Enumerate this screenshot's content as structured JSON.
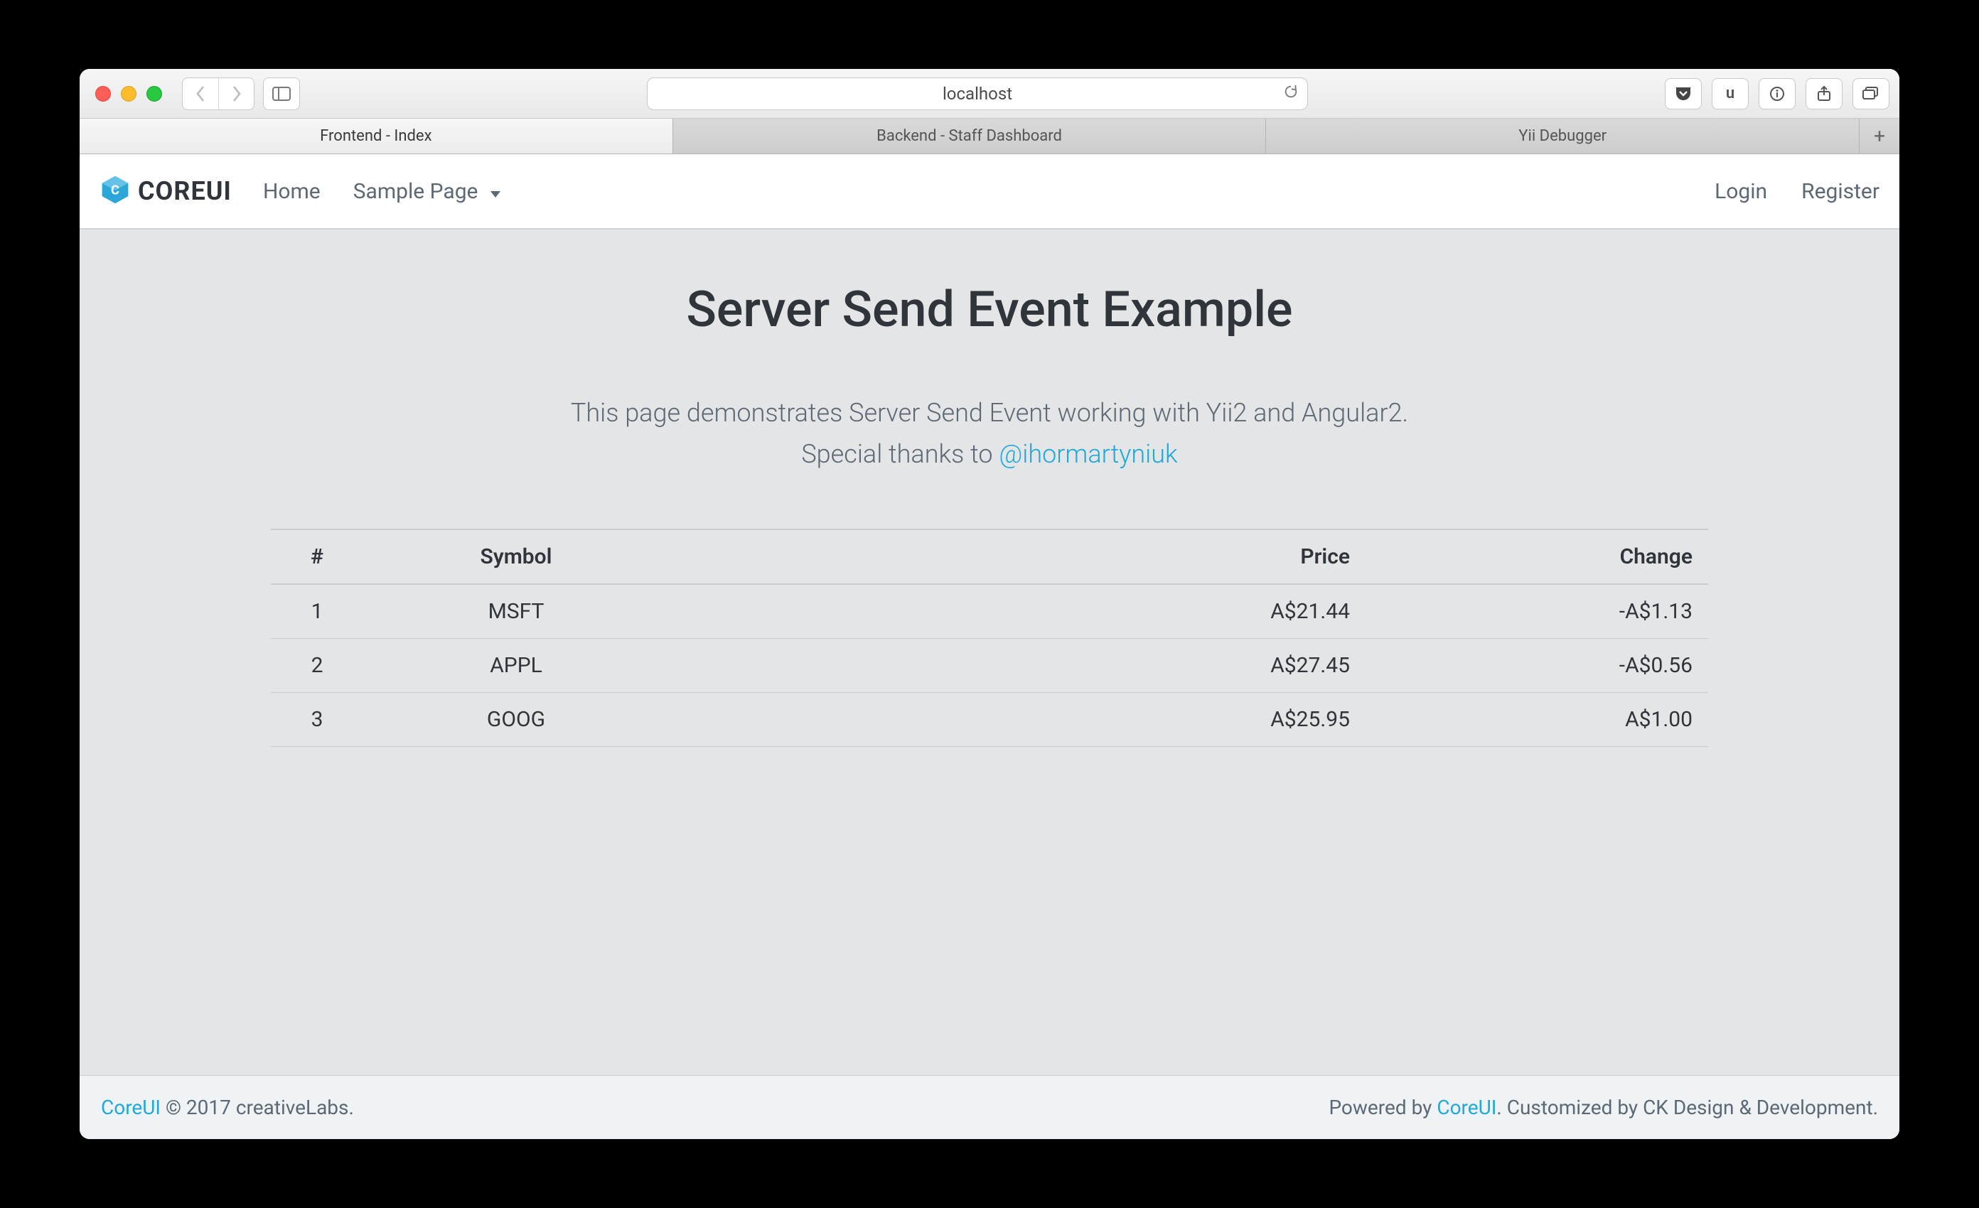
{
  "browser": {
    "address": "localhost",
    "tabs": [
      {
        "label": "Frontend - Index",
        "active": true
      },
      {
        "label": "Backend - Staff Dashboard",
        "active": false
      },
      {
        "label": "Yii Debugger",
        "active": false
      }
    ],
    "toolbar_u": "u"
  },
  "nav": {
    "brand": "COREUI",
    "links": [
      "Home",
      "Sample Page"
    ],
    "right_links": [
      "Login",
      "Register"
    ]
  },
  "page": {
    "heading": "Server Send Event Example",
    "lead1": "This page demonstrates Server Send Event working with Yii2 and Angular2.",
    "lead2_prefix": "Special thanks to ",
    "lead2_link": "@ihormartyniuk"
  },
  "table": {
    "headers": {
      "n": "#",
      "symbol": "Symbol",
      "price": "Price",
      "change": "Change"
    },
    "rows": [
      {
        "n": "1",
        "symbol": "MSFT",
        "price": "A$21.44",
        "change": "-A$1.13"
      },
      {
        "n": "2",
        "symbol": "APPL",
        "price": "A$27.45",
        "change": "-A$0.56"
      },
      {
        "n": "3",
        "symbol": "GOOG",
        "price": "A$25.95",
        "change": "A$1.00"
      }
    ]
  },
  "footer": {
    "left_link": "CoreUI",
    "left_rest": " © 2017 creativeLabs.",
    "right_prefix": "Powered by ",
    "right_link": "CoreUI",
    "right_rest": ". Customized by CK Design & Development."
  },
  "colors": {
    "accent": "#20a8d8"
  }
}
